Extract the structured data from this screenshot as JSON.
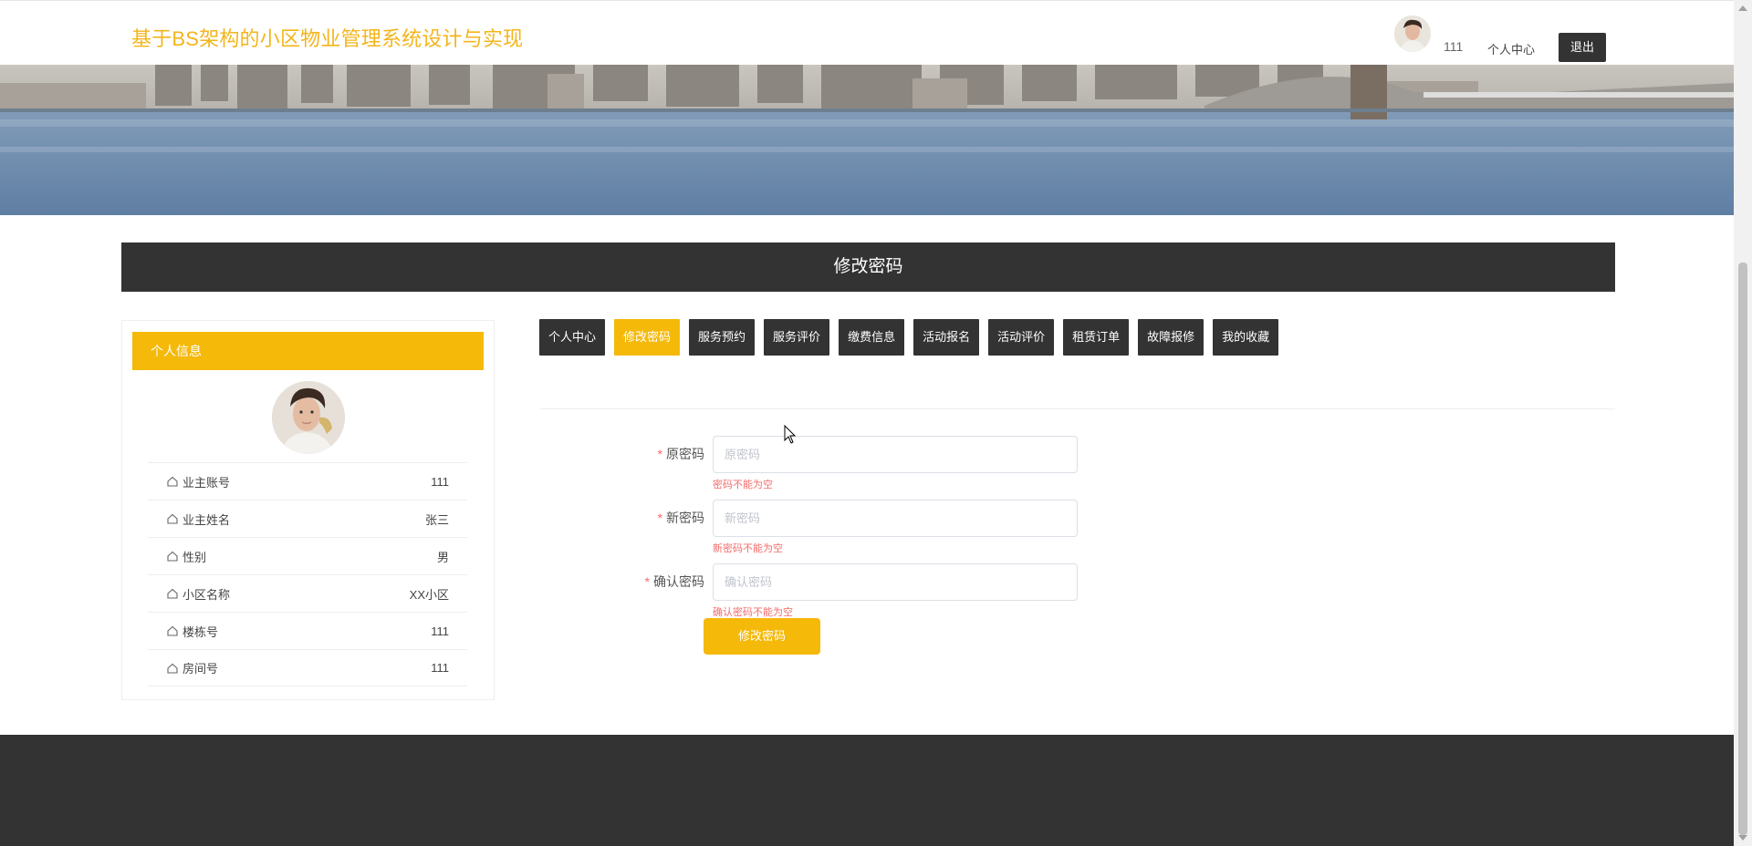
{
  "header": {
    "title": "基于BS架构的小区物业管理系统设计与实现",
    "username": "111",
    "nav_personal_center": "个人中心",
    "logout_label": "退出"
  },
  "page_title": "修改密码",
  "sidebar": {
    "heading": "个人信息",
    "rows": [
      {
        "label": "业主账号",
        "value": "111"
      },
      {
        "label": "业主姓名",
        "value": "张三"
      },
      {
        "label": "性别",
        "value": "男"
      },
      {
        "label": "小区名称",
        "value": "XX小区"
      },
      {
        "label": "楼栋号",
        "value": "111"
      },
      {
        "label": "房间号",
        "value": "111"
      }
    ]
  },
  "tabs": [
    {
      "label": "个人中心",
      "active": false
    },
    {
      "label": "修改密码",
      "active": true
    },
    {
      "label": "服务预约",
      "active": false
    },
    {
      "label": "服务评价",
      "active": false
    },
    {
      "label": "缴费信息",
      "active": false
    },
    {
      "label": "活动报名",
      "active": false
    },
    {
      "label": "活动评价",
      "active": false
    },
    {
      "label": "租赁订单",
      "active": false
    },
    {
      "label": "故障报修",
      "active": false
    },
    {
      "label": "我的收藏",
      "active": false
    }
  ],
  "form": {
    "old_password": {
      "label": "原密码",
      "placeholder": "原密码",
      "error": "密码不能为空"
    },
    "new_password": {
      "label": "新密码",
      "placeholder": "新密码",
      "error": "新密码不能为空"
    },
    "confirm_password": {
      "label": "确认密码",
      "placeholder": "确认密码",
      "error": "确认密码不能为空"
    },
    "submit_label": "修改密码"
  },
  "colors": {
    "accent": "#f5b90a",
    "title": "#f3b51b",
    "dark": "#333333",
    "error": "#f56c6c"
  },
  "banner": {
    "slide_count": 3,
    "active_slide": 1
  }
}
